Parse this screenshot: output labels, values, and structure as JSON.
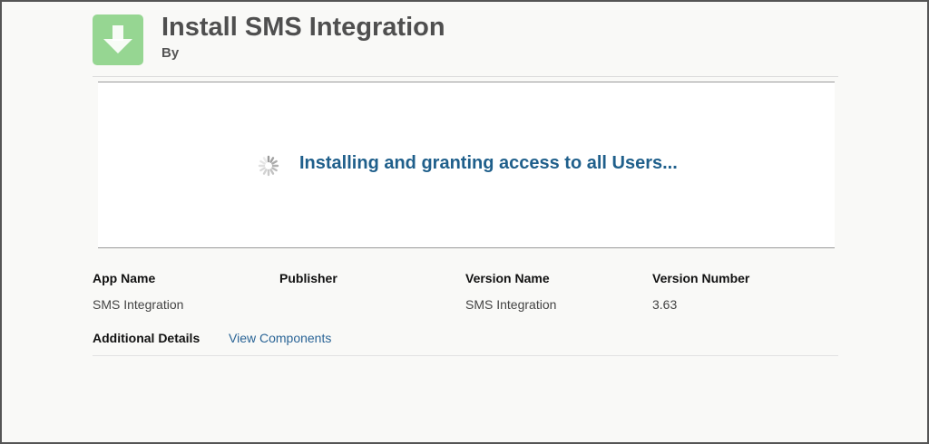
{
  "header": {
    "title": "Install SMS Integration",
    "by_label": "By",
    "icon": "download-arrow-icon",
    "icon_color": "#96d692"
  },
  "progress": {
    "message": "Installing and granting access to all Users...",
    "spinner_icon": "loading-spinner-icon",
    "message_color": "#1f5f8b"
  },
  "details": {
    "columns": [
      {
        "header": "App Name",
        "value": "SMS Integration"
      },
      {
        "header": "Publisher",
        "value": ""
      },
      {
        "header": "Version Name",
        "value": "SMS Integration"
      },
      {
        "header": "Version Number",
        "value": "3.63"
      }
    ],
    "additional_label": "Additional Details",
    "view_components_label": "View Components",
    "link_color": "#2a6496"
  }
}
